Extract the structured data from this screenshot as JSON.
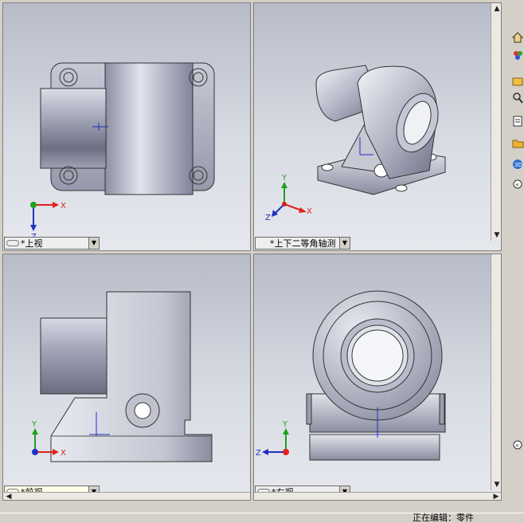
{
  "viewports": {
    "top": {
      "label": "*上视",
      "axes": {
        "x": "X",
        "z": "Z"
      }
    },
    "iso": {
      "label": "*上下二等角轴测",
      "axes": {
        "x": "X",
        "y": "Y",
        "z": "Z"
      }
    },
    "front": {
      "label": "*前视",
      "axes": {
        "x": "X",
        "y": "Y"
      }
    },
    "right": {
      "label": "*右视",
      "axes": {
        "y": "Y",
        "z": "Z"
      }
    }
  },
  "status": {
    "text": "正在编辑：零件"
  },
  "right_toolbar": {
    "icons": [
      "home-icon",
      "palette-icon",
      "folder-search-icon",
      "search-icon",
      "list-icon",
      "folder-icon",
      "3d-icon",
      "collapse-icon"
    ]
  },
  "colors": {
    "axis_x": "#e02020",
    "axis_y": "#20a020",
    "axis_z": "#2030c0",
    "background_top": "#b7bcc8",
    "background_bottom": "#e6e8ee"
  }
}
